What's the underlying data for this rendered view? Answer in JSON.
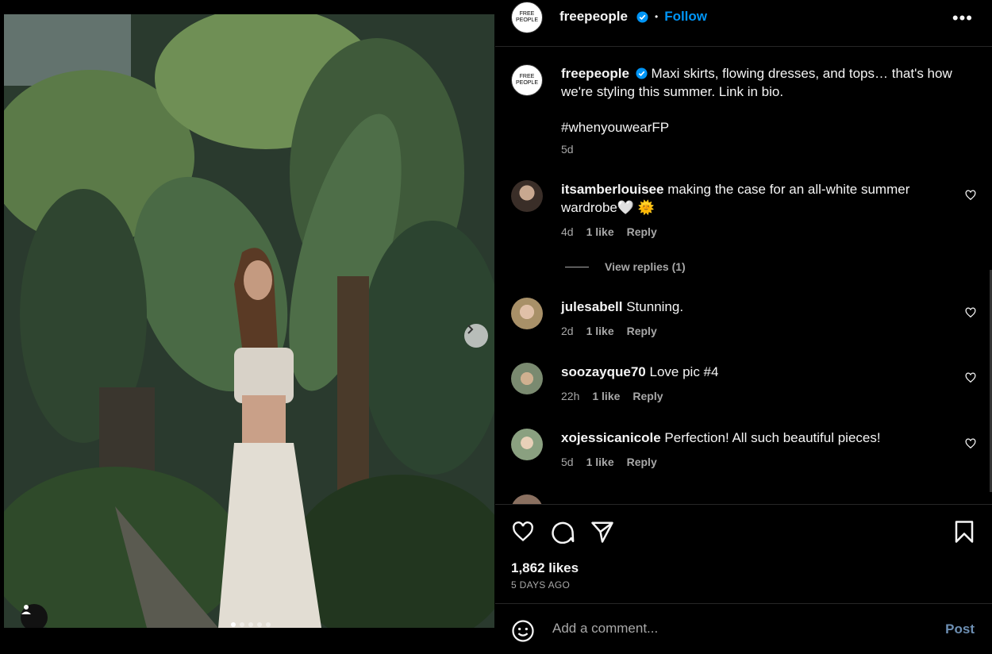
{
  "post": {
    "username": "freepeople",
    "follow_label": "Follow",
    "avatar_text": "FREE PEOPLE",
    "separator": "•",
    "more_label": "•••"
  },
  "caption": {
    "username": "freepeople",
    "text": "Maxi skirts, flowing dresses, and tops… that's how we're styling this summer. Link in bio.",
    "hashtag": "#whenyouwearFP",
    "time": "5d"
  },
  "comments": [
    {
      "username": "itsamberlouisee",
      "text": "making the case for an all-white summer wardrobe🤍 🌞",
      "time": "4d",
      "likes": "1 like",
      "reply": "Reply",
      "view_replies": "View replies (1)"
    },
    {
      "username": "julesabell",
      "text": "Stunning.",
      "time": "2d",
      "likes": "1 like",
      "reply": "Reply"
    },
    {
      "username": "soozayque70",
      "text": "Love pic #4",
      "time": "22h",
      "likes": "1 like",
      "reply": "Reply"
    },
    {
      "username": "xojessicanicole",
      "text": "Perfection! All such beautiful pieces!",
      "time": "5d",
      "likes": "1 like",
      "reply": "Reply"
    }
  ],
  "stats": {
    "likes": "1,862 likes",
    "date": "5 DAYS AGO"
  },
  "add_comment": {
    "placeholder": "Add a comment...",
    "post_label": "Post"
  },
  "carousel": {
    "count": 5,
    "active": 1
  },
  "colors": {
    "accent": "#0095f6",
    "background": "#000000",
    "muted": "#a8a8a8",
    "verified": "#0095f6"
  }
}
